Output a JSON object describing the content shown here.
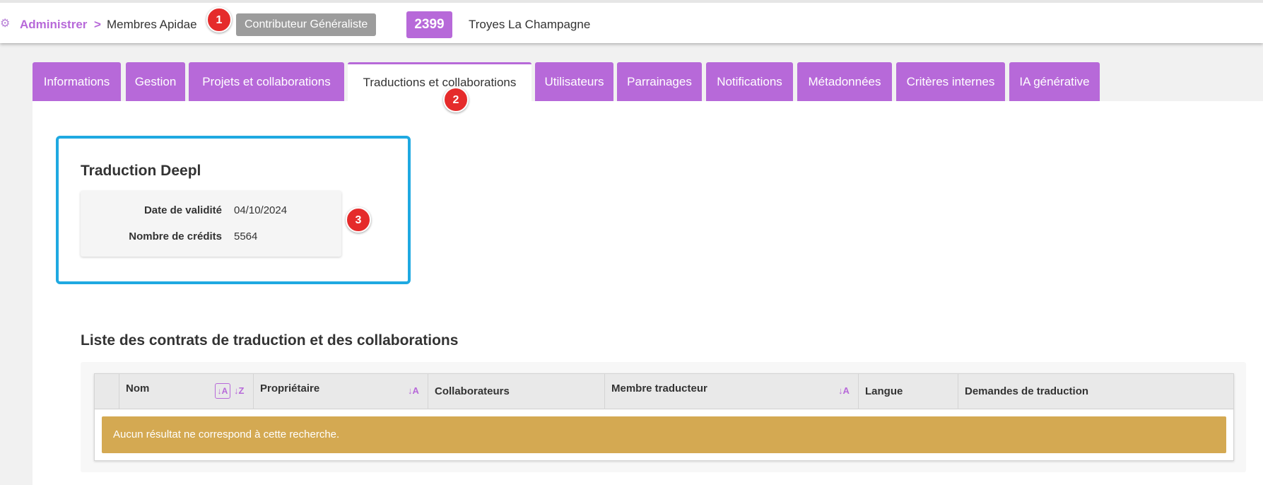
{
  "breadcrumb": {
    "admin_label": "Administrer",
    "separator": ">",
    "member_label": "Membres Apidae",
    "role_badge": "Contributeur Généraliste",
    "member_id": "2399",
    "member_name": "Troyes La Champagne"
  },
  "tabs": [
    {
      "label": "Informations"
    },
    {
      "label": "Gestion"
    },
    {
      "label": "Projets et collaborations"
    },
    {
      "label": "Traductions et collaborations",
      "active": true
    },
    {
      "label": "Utilisateurs"
    },
    {
      "label": "Parrainages"
    },
    {
      "label": "Notifications"
    },
    {
      "label": "Métadonnées"
    },
    {
      "label": "Critères internes"
    },
    {
      "label": "IA générative"
    }
  ],
  "callouts": [
    "1",
    "2",
    "3"
  ],
  "deepl": {
    "title": "Traduction Deepl",
    "validity_label": "Date de validité",
    "validity_value": "04/10/2024",
    "credits_label": "Nombre de crédits",
    "credits_value": "5564"
  },
  "contracts": {
    "title": "Liste des contrats de traduction et des collaborations",
    "columns": [
      "Nom",
      "Propriétaire",
      "Collaborateurs",
      "Membre traducteur",
      "Langue",
      "Demandes de traduction"
    ],
    "empty_message": "Aucun résultat ne correspond à cette recherche."
  },
  "colors": {
    "accent": "#b769d9",
    "highlight": "#1fa9e1",
    "callout": "#e52b2b",
    "empty_row": "#d4a952",
    "badge_grey": "#9c9c9c"
  }
}
